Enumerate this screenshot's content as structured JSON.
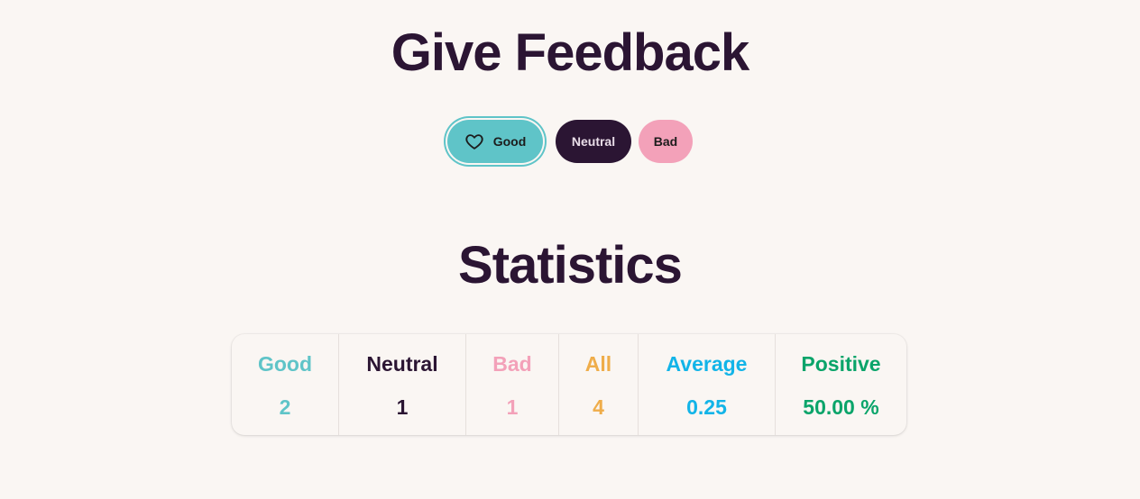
{
  "header": {
    "title": "Give Feedback"
  },
  "feedback_buttons": {
    "good_label": "Good",
    "neutral_label": "Neutral",
    "bad_label": "Bad"
  },
  "statistics": {
    "title": "Statistics",
    "items": [
      {
        "label": "Good",
        "value": "2",
        "color": "#5fc4c8"
      },
      {
        "label": "Neutral",
        "value": "1",
        "color": "#2b1533"
      },
      {
        "label": "Bad",
        "value": "1",
        "color": "#f3a1b9"
      },
      {
        "label": "All",
        "value": "4",
        "color": "#efad4a"
      },
      {
        "label": "Average",
        "value": "0.25",
        "color": "#12b4e8"
      },
      {
        "label": "Positive",
        "value": "50.00 %",
        "color": "#0aa46a"
      }
    ]
  },
  "colors": {
    "background": "#faf6f3",
    "primary_dark": "#2b1533",
    "good": "#5fc4c8",
    "bad": "#f3a1b9"
  },
  "icons": {
    "good_button_icon": "heart-icon"
  }
}
